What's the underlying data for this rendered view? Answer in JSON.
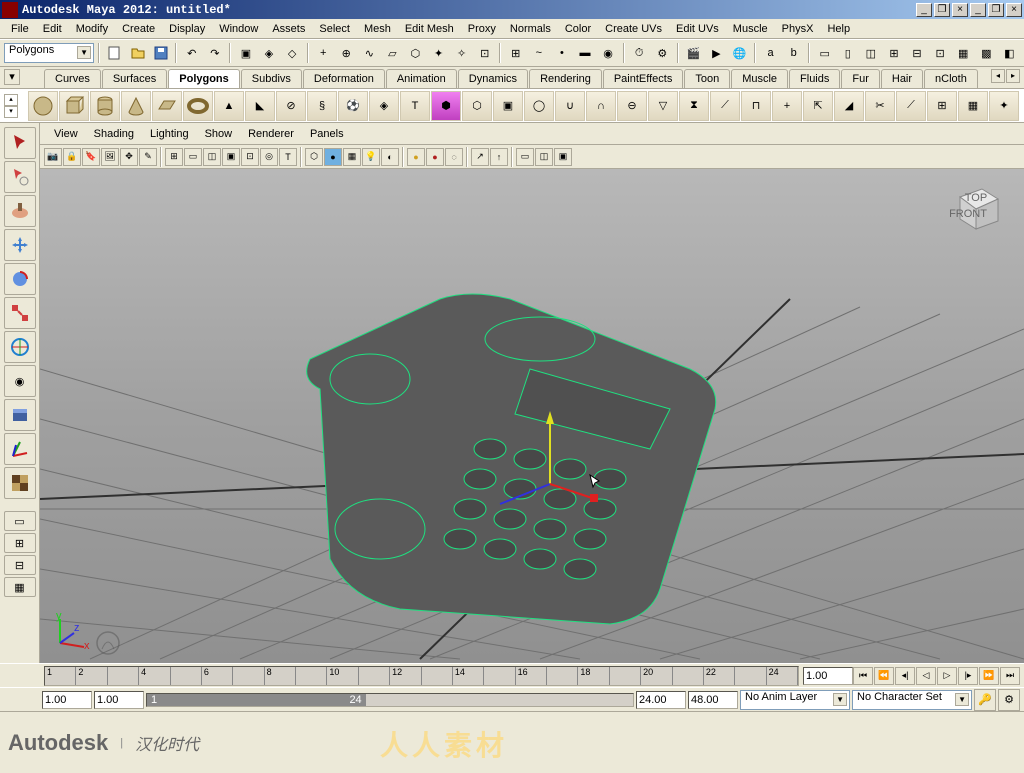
{
  "window": {
    "title": "Autodesk Maya 2012: untitled*"
  },
  "menu": [
    "File",
    "Edit",
    "Modify",
    "Create",
    "Display",
    "Window",
    "Assets",
    "Select",
    "Mesh",
    "Edit Mesh",
    "Proxy",
    "Normals",
    "Color",
    "Create UVs",
    "Edit UVs",
    "Muscle",
    "PhysX",
    "Help"
  ],
  "mode_dropdown": "Polygons",
  "shelf_tabs": [
    "Curves",
    "Surfaces",
    "Polygons",
    "Subdivs",
    "Deformation",
    "Animation",
    "Dynamics",
    "Rendering",
    "PaintEffects",
    "Toon",
    "Muscle",
    "Fluids",
    "Fur",
    "Hair",
    "nCloth"
  ],
  "shelf_active": "Polygons",
  "panel_menu": [
    "View",
    "Shading",
    "Lighting",
    "Show",
    "Renderer",
    "Panels"
  ],
  "viewcube": {
    "top": "TOP",
    "front": "FRONT"
  },
  "timeline": {
    "ticks": [
      "1",
      "2",
      "",
      "4",
      "",
      "6",
      "",
      "8",
      "",
      "10",
      "",
      "12",
      "",
      "14",
      "",
      "16",
      "",
      "18",
      "",
      "20",
      "",
      "22",
      "",
      "24"
    ],
    "current": "1.00"
  },
  "range": {
    "start_outer": "1.00",
    "start_inner": "1.00",
    "slider_a": "1",
    "slider_b": "24",
    "end_inner": "24.00",
    "end_outer": "48.00",
    "anim_layer": "No Anim Layer",
    "char_set": "No Character Set"
  },
  "footer_brand_a": "Autodesk",
  "footer_brand_b": "汉化时代",
  "watermark": "人人素材"
}
